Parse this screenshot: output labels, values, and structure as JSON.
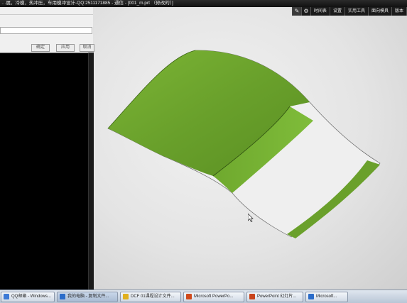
{
  "window": {
    "title": "…属，冷模，热冲压，车用模冲设计-QQ:2511171885 - 通信 - [001_m.prt （修改的）]"
  },
  "toolbar": {
    "buttons": [
      {
        "label": "",
        "icon": "pencil-icon",
        "active": true
      },
      {
        "label": "",
        "icon": "gear-icon",
        "active": false
      },
      {
        "label": "时间表"
      },
      {
        "label": "设置"
      },
      {
        "label": "实用工具"
      },
      {
        "label": "面向模具"
      },
      {
        "label": "版本"
      }
    ]
  },
  "dialog": {
    "input_value": "",
    "buttons": [
      {
        "label": "确定"
      },
      {
        "label": "应用"
      },
      {
        "label": "取消"
      }
    ]
  },
  "taskbar": {
    "items": [
      {
        "label": "QQ邮箱 - Windows...",
        "color": "#3c7ad6"
      },
      {
        "label": "我的电脑 - 复制文件...",
        "color": "#2b6cc9"
      },
      {
        "label": "DCF 01课程设计文件...",
        "color": "#e0b020"
      },
      {
        "label": "Microsoft PowerPo...",
        "color": "#d04a1c"
      },
      {
        "label": "PowerPoint 幻灯片...",
        "color": "#c8431b"
      },
      {
        "label": "Microsoft...",
        "color": "#2b6cc9"
      }
    ]
  },
  "colors": {
    "surface_green": "#6aa02b",
    "surface_green_dark": "#4f7f1c",
    "viewport_bg": "#e6e6e6"
  }
}
